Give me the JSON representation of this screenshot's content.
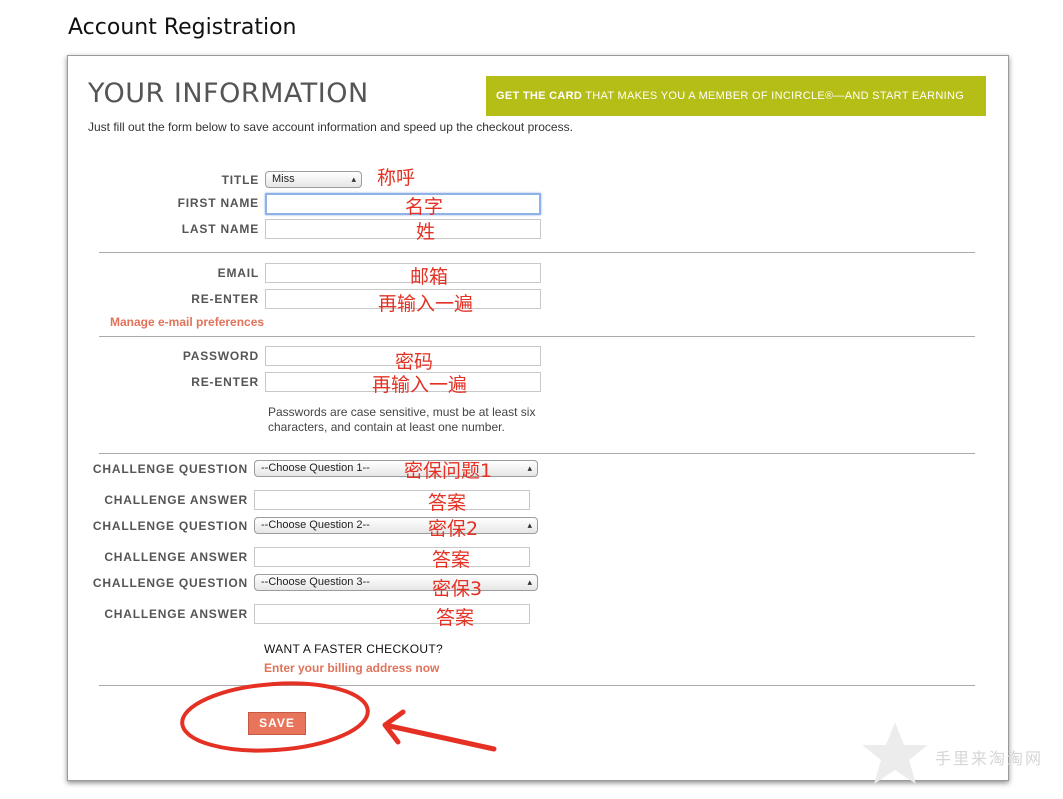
{
  "page": {
    "heading": "Account Registration"
  },
  "section": {
    "title": "YOUR INFORMATION",
    "subtitle": "Just fill out the form below to save account information and speed up the checkout process."
  },
  "promo": {
    "highlight": "GET THE CARD",
    "text": "THAT MAKES YOU A MEMBER OF INCIRCLE®—AND START EARNING POINTS",
    "arrow_icon": "▸"
  },
  "form": {
    "title_label": "TITLE",
    "title_value": "Miss",
    "first_name_label": "FIRST NAME",
    "last_name_label": "LAST NAME",
    "email_label": "EMAIL",
    "email_reenter_label": "RE-ENTER",
    "manage_email_link": "Manage e-mail preferences",
    "password_label": "PASSWORD",
    "password_reenter_label": "RE-ENTER",
    "password_note": "Passwords are case sensitive, must be at least six characters, and contain at least one number.",
    "challenge_question_label": "CHALLENGE QUESTION",
    "challenge_answer_label": "CHALLENGE ANSWER",
    "challenge_questions": [
      "--Choose Question 1--",
      "--Choose Question 2--",
      "--Choose Question 3--"
    ],
    "faster_checkout": "WANT A FASTER CHECKOUT?",
    "billing_link": "Enter your billing address now",
    "save_label": "SAVE"
  },
  "annotations": {
    "title": "称呼",
    "first_name": "名字",
    "last_name": "姓",
    "email": "邮箱",
    "email_reenter": "再输入一遍",
    "password": "密码",
    "password_reenter": "再输入一遍",
    "question1": "密保问题1",
    "answer1": "答案",
    "question2": "密保2",
    "answer2": "答案",
    "question3": "密保3",
    "answer3": "答案"
  },
  "watermark": "手里来淘淘网",
  "colors": {
    "promo_bg": "#b5bd17",
    "link": "#e0735a",
    "save_button": "#e8755b",
    "annotation": "#e43124",
    "focus_ring": "#8fb3e6"
  }
}
